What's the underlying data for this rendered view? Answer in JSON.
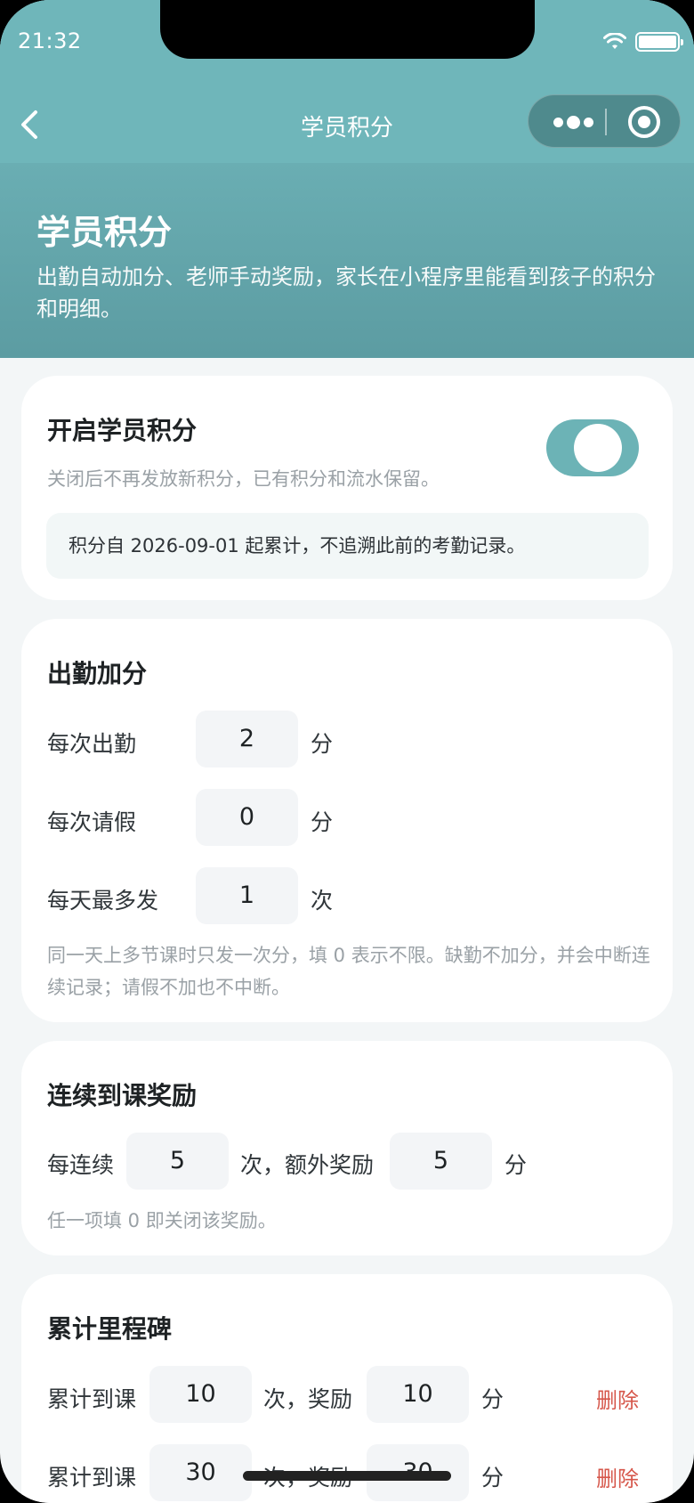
{
  "status_bar": {
    "time": "21:32"
  },
  "nav": {
    "title": "学员积分"
  },
  "hero": {
    "title": "学员积分",
    "description": "出勤自动加分、老师手动奖励，家长在小程序里能看到孩子的积分和明细。"
  },
  "enable_card": {
    "title": "开启学员积分",
    "toggle_on": true,
    "hint": "关闭后不再发放新积分，已有积分和流水保留。",
    "note": "积分自 2026-09-01 起累计，不追溯此前的考勤记录。"
  },
  "attendance_card": {
    "title": "出勤加分",
    "rows": [
      {
        "label": "每次出勤",
        "value": "2",
        "unit": "分"
      },
      {
        "label": "每次请假",
        "value": "0",
        "unit": "分"
      },
      {
        "label": "每天最多发",
        "value": "1",
        "unit": "次"
      }
    ],
    "hint": "同一天上多节课时只发一次分，填 0 表示不限。缺勤不加分，并会中断连续记录；请假不加也不中断。"
  },
  "streak_card": {
    "title": "连续到课奖励",
    "prefix": "每连续",
    "count": "5",
    "middle": "次，额外奖励",
    "points": "5",
    "suffix": "分",
    "hint": "任一项填 0 即关闭该奖励。"
  },
  "milestone_card": {
    "title": "累计里程碑",
    "rows": [
      {
        "label": "累计到课",
        "count": "10",
        "middle": "次，奖励",
        "points": "10",
        "unit": "分",
        "delete": "删除"
      },
      {
        "label": "累计到课",
        "count": "30",
        "middle": "次，奖励",
        "points": "30",
        "unit": "分",
        "delete": "删除"
      }
    ]
  }
}
